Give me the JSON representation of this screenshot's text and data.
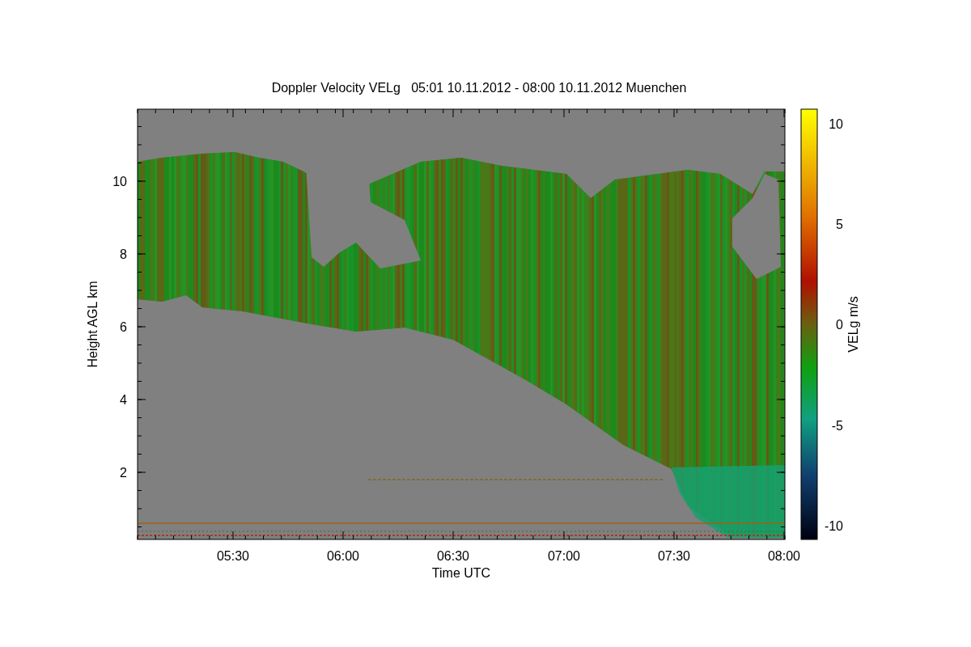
{
  "title": "Doppler Velocity VELg   05:01 10.11.2012 - 08:00 10.11.2012 Muenchen",
  "xlabel": "Time UTC",
  "ylabel": "Height AGL km",
  "xticks": [
    "05:30",
    "06:00",
    "06:30",
    "07:00",
    "07:30",
    "08:00"
  ],
  "yticks": [
    "10",
    "8",
    "6",
    "4",
    "2"
  ],
  "colorbar": {
    "label": "VELg m/s",
    "ticks": [
      "10",
      "5",
      "0",
      "-5",
      "-10"
    ]
  }
}
